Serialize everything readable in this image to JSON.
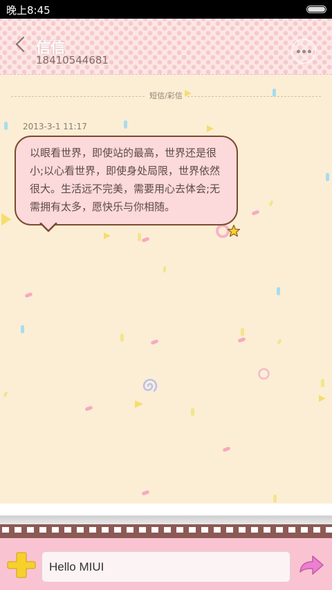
{
  "status_bar": {
    "time": "晚上8:45"
  },
  "header": {
    "contact_name": "信信",
    "contact_number": "18410544681"
  },
  "thread": {
    "type_label": "短信/彩信",
    "messages": [
      {
        "timestamp": "2013-3-1 11:17",
        "text": "以眼看世界，即使站的最高，世界还是很小;以心看世界，即使身处局限，世界依然很大。生活远不完美，需要用心去体会;无需拥有太多，愿快乐与你相随。"
      }
    ]
  },
  "composer": {
    "input_value": "Hello MIUI",
    "input_placeholder": ""
  },
  "icons": [
    "back-arrow-icon",
    "more-options-icon",
    "battery-icon",
    "add-icon",
    "send-arrow-icon"
  ],
  "colors": {
    "bubble_fill": "#fcd9db",
    "bubble_border": "#7c4b2e",
    "background": "#fbeed5",
    "input_bar": "#f9c3d1",
    "add_icon": "#f7d02c",
    "send_icon": "#ec7fd0"
  }
}
